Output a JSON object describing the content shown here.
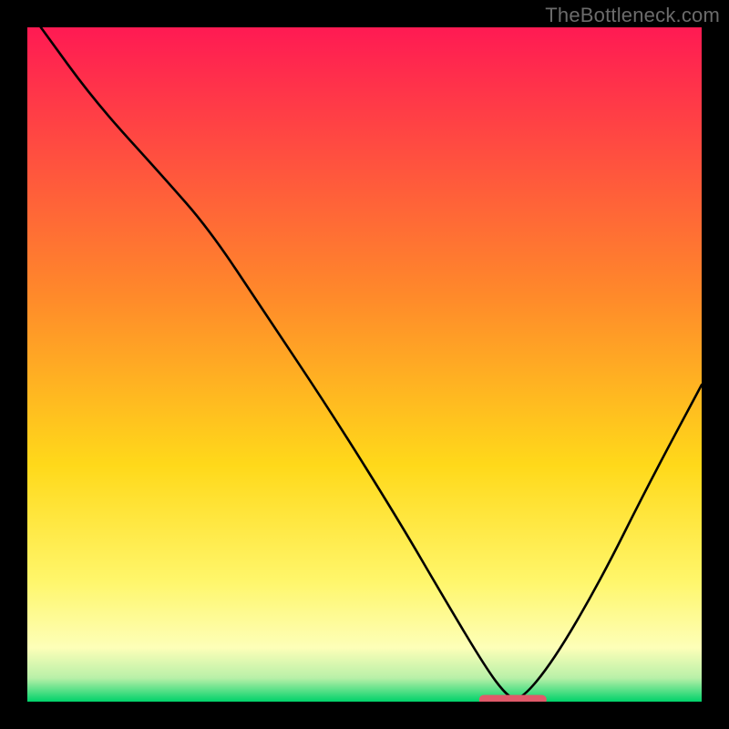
{
  "watermark": "TheBottleneck.com",
  "chart_data": {
    "type": "line",
    "title": "",
    "xlabel": "",
    "ylabel": "",
    "xlim": [
      0,
      100
    ],
    "ylim": [
      0,
      100
    ],
    "grid": false,
    "legend": false,
    "gradient_stops": [
      {
        "offset": 0.0,
        "color": "#ff1a53"
      },
      {
        "offset": 0.4,
        "color": "#ff8a2a"
      },
      {
        "offset": 0.65,
        "color": "#ffd91a"
      },
      {
        "offset": 0.82,
        "color": "#fff66a"
      },
      {
        "offset": 0.92,
        "color": "#fdffb8"
      },
      {
        "offset": 0.965,
        "color": "#b8f0a8"
      },
      {
        "offset": 1.0,
        "color": "#00d26a"
      }
    ],
    "series": [
      {
        "name": "bottleneck-curve",
        "color": "#000000",
        "x": [
          2,
          10,
          20,
          27,
          35,
          45,
          55,
          62,
          68,
          71,
          73,
          78,
          85,
          92,
          100
        ],
        "y": [
          100,
          89,
          78,
          70,
          58,
          43,
          27,
          15,
          5,
          1,
          0,
          6,
          18,
          32,
          47
        ]
      }
    ],
    "marker": {
      "name": "optimal-range",
      "shape": "capsule",
      "color": "#e05a6a",
      "x_start": 67,
      "x_end": 77,
      "y": 0.3,
      "height_pct": 1.4
    }
  }
}
